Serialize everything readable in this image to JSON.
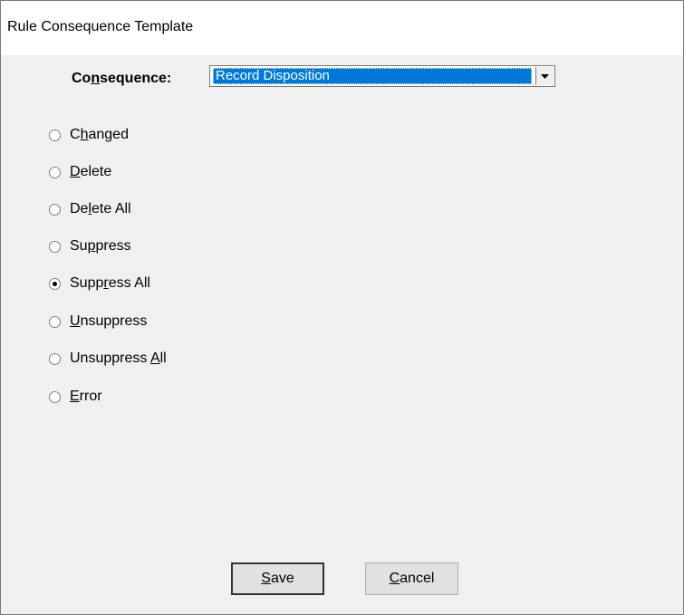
{
  "window": {
    "title": "Rule Consequence Template"
  },
  "consequence": {
    "label_pre": "Co",
    "label_mnemonic": "n",
    "label_post": "sequence:",
    "selected": "Record Disposition"
  },
  "radios": [
    {
      "pre": "C",
      "mn": "h",
      "post": "anged",
      "checked": false
    },
    {
      "pre": "",
      "mn": "D",
      "post": "elete",
      "checked": false
    },
    {
      "pre": "De",
      "mn": "l",
      "post": "ete All",
      "checked": false
    },
    {
      "pre": "Su",
      "mn": "p",
      "post": "press",
      "checked": false
    },
    {
      "pre": "Supp",
      "mn": "r",
      "post": "ess All",
      "checked": true
    },
    {
      "pre": "",
      "mn": "U",
      "post": "nsuppress",
      "checked": false
    },
    {
      "pre": "Unsuppress ",
      "mn": "A",
      "post": "ll",
      "checked": false
    },
    {
      "pre": "",
      "mn": "E",
      "post": "rror",
      "checked": false
    }
  ],
  "buttons": {
    "save": {
      "mn": "S",
      "post": "ave"
    },
    "cancel": {
      "mn": "C",
      "post": "ancel"
    }
  }
}
